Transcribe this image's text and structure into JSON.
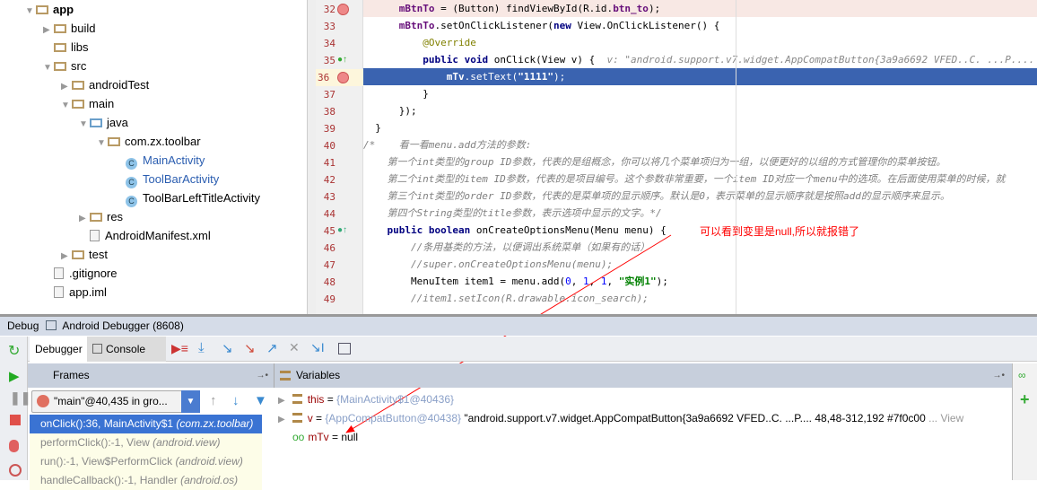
{
  "project_tree": [
    {
      "label": "app",
      "indent": 0,
      "expand": "open",
      "icon": "module",
      "bold": true
    },
    {
      "label": "build",
      "indent": 1,
      "expand": "closed",
      "icon": "folder"
    },
    {
      "label": "libs",
      "indent": 1,
      "expand": "none",
      "icon": "folder"
    },
    {
      "label": "src",
      "indent": 1,
      "expand": "open",
      "icon": "folder"
    },
    {
      "label": "androidTest",
      "indent": 2,
      "expand": "closed",
      "icon": "folder"
    },
    {
      "label": "main",
      "indent": 2,
      "expand": "open",
      "icon": "folder"
    },
    {
      "label": "java",
      "indent": 3,
      "expand": "open",
      "icon": "source-folder"
    },
    {
      "label": "com.zx.toolbar",
      "indent": 4,
      "expand": "open",
      "icon": "package"
    },
    {
      "label": "MainActivity",
      "indent": 5,
      "expand": "none",
      "icon": "class",
      "link": true
    },
    {
      "label": "ToolBarActivity",
      "indent": 5,
      "expand": "none",
      "icon": "class",
      "link": true
    },
    {
      "label": "ToolBarLeftTitleActivity",
      "indent": 5,
      "expand": "none",
      "icon": "class"
    },
    {
      "label": "res",
      "indent": 3,
      "expand": "closed",
      "icon": "folder"
    },
    {
      "label": "AndroidManifest.xml",
      "indent": 3,
      "expand": "none",
      "icon": "file"
    },
    {
      "label": "test",
      "indent": 2,
      "expand": "closed",
      "icon": "folder"
    },
    {
      "label": ".gitignore",
      "indent": 1,
      "expand": "none",
      "icon": "file"
    },
    {
      "label": "app.iml",
      "indent": 1,
      "expand": "none",
      "icon": "file"
    }
  ],
  "editor": {
    "lines": [
      {
        "n": "32",
        "marker": "breakpoint",
        "state": "breakpoint",
        "html": "      <span class='fld'>mBtnTo</span> = (Button) findViewById(R.id.<span class='fld'>btn_to</span>);"
      },
      {
        "n": "33",
        "html": "      <span class='fld'>mBtnTo</span>.setOnClickListener(<span class='kw'>new</span> View.OnClickListener() {"
      },
      {
        "n": "34",
        "html": "          <span class='ann'>@Override</span>"
      },
      {
        "n": "35",
        "marker": "implements",
        "html": "          <span class='kw'>public void</span> onClick(View v) {  <span class='hint'>v: \"android.support.v7.widget.AppCompatButton{3a9a6692 VFED..C. ...P.... 48,48-312,192 #7f0c00</span>"
      },
      {
        "n": "36",
        "marker": "breakpoint",
        "state": "current",
        "html": "              <span style='font-weight:bold'>mTv</span>.setText(<span style='font-weight:bold'>\"1111\"</span>);"
      },
      {
        "n": "37",
        "html": "          }"
      },
      {
        "n": "38",
        "html": "      });"
      },
      {
        "n": "39",
        "html": "  }"
      },
      {
        "n": "40",
        "html": "<span class='cm'>/*    看一看menu.add方法的参数:</span>"
      },
      {
        "n": "41",
        "html": "<span class='cm'>    第一个int类型的group ID参数，代表的是组概念，你可以将几个菜单项归为一组，以便更好的以组的方式管理你的菜单按钮。</span>"
      },
      {
        "n": "42",
        "html": "<span class='cm'>    第二个int类型的item ID参数，代表的是项目编号。这个参数非常重要，一个item ID对应一个menu中的选项。在后面使用菜单的时候，就</span>"
      },
      {
        "n": "43",
        "html": "<span class='cm'>    第三个int类型的order ID参数，代表的是菜单项的显示顺序。默认是0，表示菜单的显示顺序就是按照add的显示顺序来显示。</span>"
      },
      {
        "n": "44",
        "html": "<span class='cm'>    第四个String类型的title参数，表示选项中显示的文字。*/</span>"
      },
      {
        "n": "45",
        "marker": "override",
        "html": "    <span class='kw'>public boolean</span> onCreateOptionsMenu(Menu menu) {"
      },
      {
        "n": "46",
        "html": "        <span class='cm'>//条用基类的方法，以便调出系统菜单（如果有的话）</span>"
      },
      {
        "n": "47",
        "html": "        <span class='cm'>//super.onCreateOptionsMenu(menu);</span>"
      },
      {
        "n": "48",
        "html": "        MenuItem item1 = menu.add(<span class='num'>0</span>, <span class='num'>1</span>, <span class='num'>1</span>, <span class='str'>\"实例1\"</span>);"
      },
      {
        "n": "49",
        "html": "        <span class='cm'>//item1.setIcon(R.drawable.icon_search);</span>"
      }
    ]
  },
  "annotation": {
    "text": "可以看到变里是null,所以就报错了",
    "color": "#ff0000"
  },
  "debug": {
    "title": "Debug",
    "config": "Android Debugger (8608)",
    "tabs": [
      "Debugger",
      "Console"
    ],
    "frames_title": "Frames",
    "variables_title": "Variables",
    "thread": "\"main\"@40,435 in gro...",
    "frames": [
      {
        "method": "onClick():36, MainActivity$1",
        "pkg": "(com.zx.toolbar)",
        "selected": true
      },
      {
        "method": "performClick():-1, View",
        "pkg": "(android.view)"
      },
      {
        "method": "run():-1, View$PerformClick",
        "pkg": "(android.view)"
      },
      {
        "method": "handleCallback():-1, Handler",
        "pkg": "(android.os)"
      }
    ],
    "variables": [
      {
        "name": "this",
        "value": "{MainActivity$1@40436}",
        "extra": ""
      },
      {
        "name": "v",
        "value": "{AppCompatButton@40438}",
        "extra": "\"android.support.v7.widget.AppCompatButton{3a9a6692 VFED..C. ...P.... 48,48-312,192 #7f0c00",
        "link": "... View"
      },
      {
        "name": "mTv",
        "value": "null",
        "watch": true
      }
    ]
  }
}
